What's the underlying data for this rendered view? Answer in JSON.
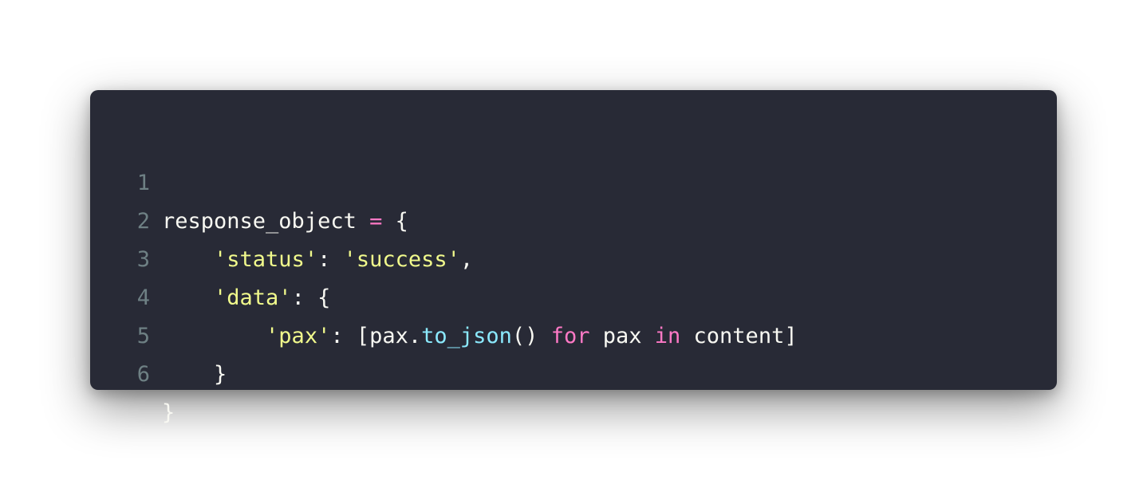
{
  "colors": {
    "background": "#282a36",
    "plain": "#f8f8f2",
    "string": "#f1fa8c",
    "keyword": "#ff79c6",
    "function": "#8be9fd",
    "line_number": "#6e8084"
  },
  "lines": [
    {
      "number": "1",
      "tokens": [
        {
          "text": "response_object ",
          "kind": "plain"
        },
        {
          "text": "=",
          "kind": "op"
        },
        {
          "text": " {",
          "kind": "plain"
        }
      ]
    },
    {
      "number": "2",
      "tokens": [
        {
          "text": "    ",
          "kind": "plain"
        },
        {
          "text": "'status'",
          "kind": "str"
        },
        {
          "text": ": ",
          "kind": "plain"
        },
        {
          "text": "'success'",
          "kind": "str"
        },
        {
          "text": ",",
          "kind": "plain"
        }
      ]
    },
    {
      "number": "3",
      "tokens": [
        {
          "text": "    ",
          "kind": "plain"
        },
        {
          "text": "'data'",
          "kind": "str"
        },
        {
          "text": ": {",
          "kind": "plain"
        }
      ]
    },
    {
      "number": "4",
      "tokens": [
        {
          "text": "        ",
          "kind": "plain"
        },
        {
          "text": "'pax'",
          "kind": "str"
        },
        {
          "text": ": [pax.",
          "kind": "plain"
        },
        {
          "text": "to_json",
          "kind": "fn"
        },
        {
          "text": "() ",
          "kind": "plain"
        },
        {
          "text": "for",
          "kind": "kw"
        },
        {
          "text": " pax ",
          "kind": "plain"
        },
        {
          "text": "in",
          "kind": "kw"
        },
        {
          "text": " content]",
          "kind": "plain"
        }
      ]
    },
    {
      "number": "5",
      "tokens": [
        {
          "text": "    }",
          "kind": "plain"
        }
      ]
    },
    {
      "number": "6",
      "tokens": [
        {
          "text": "}",
          "kind": "plain"
        }
      ]
    }
  ]
}
